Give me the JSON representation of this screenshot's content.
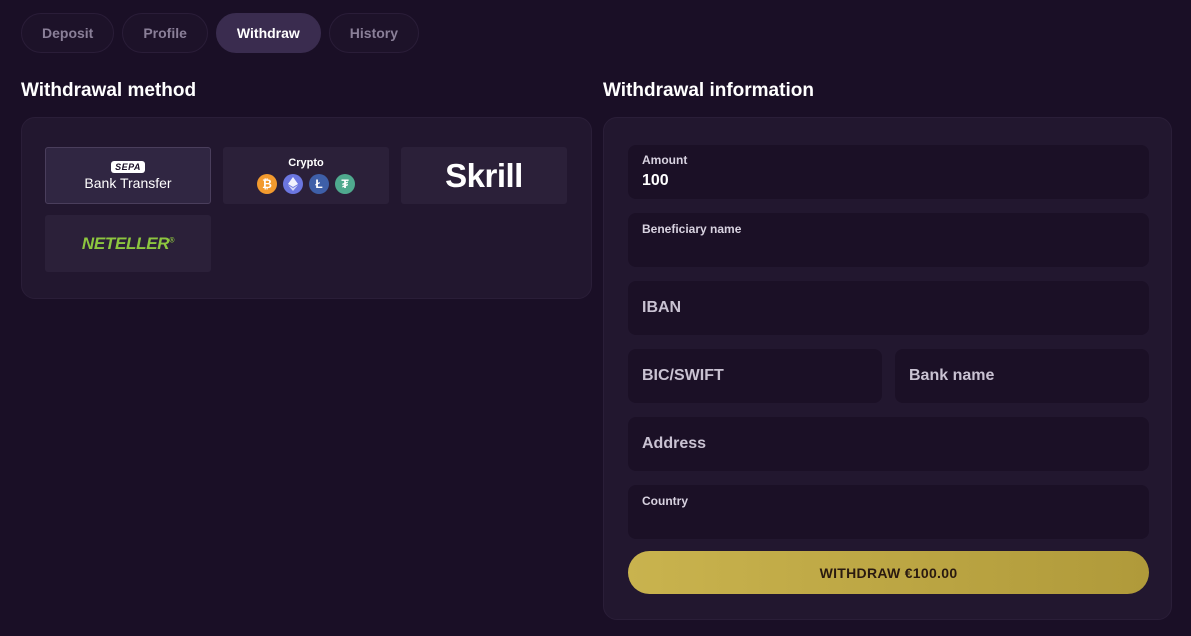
{
  "tabs": [
    {
      "label": "Deposit"
    },
    {
      "label": "Profile"
    },
    {
      "label": "Withdraw"
    },
    {
      "label": "History"
    }
  ],
  "active_tab": "Withdraw",
  "withdrawal_method": {
    "title": "Withdrawal method",
    "methods": {
      "sepa": {
        "badge": "SEPA",
        "label": "Bank Transfer",
        "selected": true
      },
      "crypto": {
        "label": "Crypto",
        "coins": [
          "bitcoin-icon",
          "ethereum-icon",
          "litecoin-icon",
          "tether-icon"
        ]
      },
      "skrill": {
        "label": "Skrill"
      },
      "neteller": {
        "label": "NETELLER",
        "mark": "®"
      }
    }
  },
  "withdrawal_info": {
    "title": "Withdrawal information",
    "amount": {
      "label": "Amount",
      "value": "100"
    },
    "beneficiary": {
      "label": "Beneficiary name",
      "value": ""
    },
    "iban": {
      "placeholder": "IBAN"
    },
    "bic": {
      "placeholder": "BIC/SWIFT"
    },
    "bank_name": {
      "placeholder": "Bank name"
    },
    "address": {
      "placeholder": "Address"
    },
    "country": {
      "label": "Country",
      "value": ""
    },
    "submit_label": "WITHDRAW €100.00"
  },
  "colors": {
    "background": "#1a0f26",
    "panel": "#22172f",
    "accent_button": "#c9b34e",
    "neteller_green": "#8dc63f"
  }
}
